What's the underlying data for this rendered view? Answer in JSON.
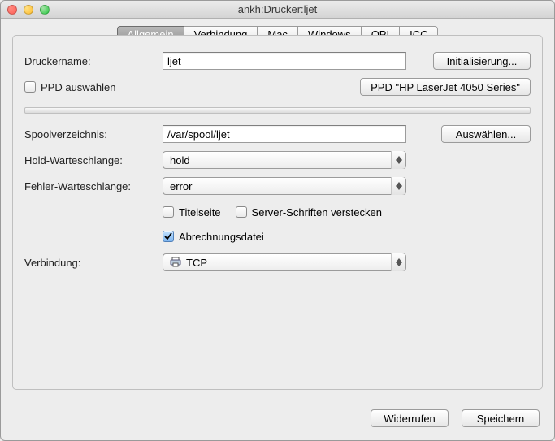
{
  "window": {
    "title": "ankh:Drucker:ljet"
  },
  "tabs": {
    "items": [
      {
        "label": "Allgemein"
      },
      {
        "label": "Verbindung"
      },
      {
        "label": "Mac"
      },
      {
        "label": "Windows"
      },
      {
        "label": "OPI"
      },
      {
        "label": "ICC"
      }
    ],
    "active_index": 0
  },
  "labels": {
    "printer_name": "Druckername:",
    "ppd_select": "PPD auswählen",
    "spool_dir": "Spoolverzeichnis:",
    "hold_queue": "Hold-Warteschlange:",
    "error_queue": "Fehler-Warteschlange:",
    "titlepage": "Titelseite",
    "hide_server_fonts": "Server-Schriften verstecken",
    "accounting_file": "Abrechnungsdatei",
    "connection": "Verbindung:"
  },
  "values": {
    "printer_name": "ljet",
    "spool_dir": "/var/spool/ljet",
    "hold_queue": "hold",
    "error_queue": "error",
    "connection": "TCP"
  },
  "checkboxes": {
    "ppd_select": false,
    "titlepage": false,
    "hide_server_fonts": false,
    "accounting_file": true
  },
  "buttons": {
    "init": "Initialisierung...",
    "ppd_info": "PPD \"HP LaserJet 4050 Series\"",
    "choose": "Auswählen...",
    "revert": "Widerrufen",
    "save": "Speichern"
  }
}
